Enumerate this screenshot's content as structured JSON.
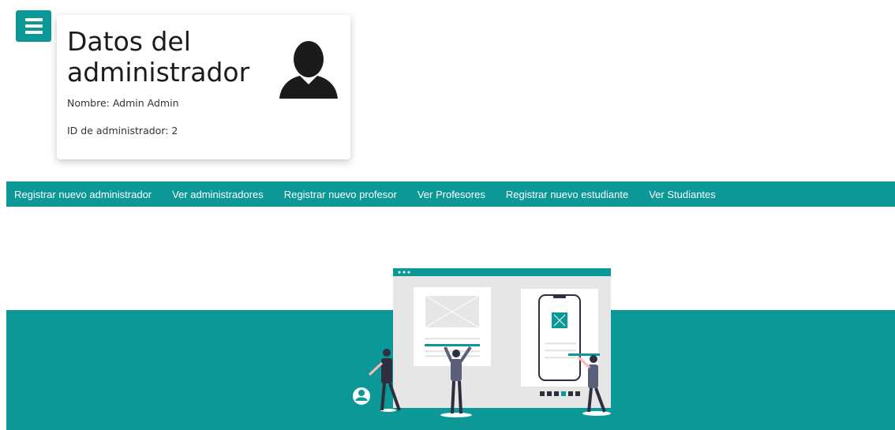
{
  "header": {
    "menu_icon": "hamburger-menu-icon"
  },
  "admin_card": {
    "title": "Datos del administrador",
    "name_line": "Nombre: Admin Admin",
    "id_line": "ID de administrador: 2",
    "avatar_icon": "user-silhouette-icon"
  },
  "nav": {
    "items": [
      {
        "label": "Registrar nuevo administrador"
      },
      {
        "label": "Ver administradores"
      },
      {
        "label": "Registrar nuevo profesor"
      },
      {
        "label": "Ver Profesores"
      },
      {
        "label": "Registrar nuevo estudiante"
      },
      {
        "label": "Ver Studiantes"
      }
    ]
  },
  "colors": {
    "accent": "#0b9896",
    "text_dark": "#1b1b1b",
    "figure_dark": "#2f2e41",
    "panel_gray": "#e6e6e6"
  }
}
